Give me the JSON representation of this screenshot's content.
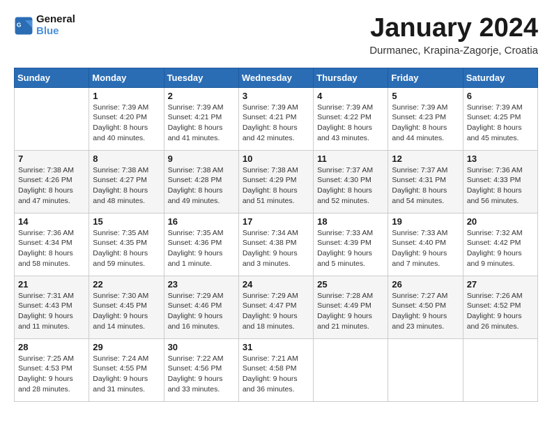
{
  "logo": {
    "line1": "General",
    "line2": "Blue"
  },
  "title": "January 2024",
  "subtitle": "Durmanec, Krapina-Zagorje, Croatia",
  "weekdays": [
    "Sunday",
    "Monday",
    "Tuesday",
    "Wednesday",
    "Thursday",
    "Friday",
    "Saturday"
  ],
  "weeks": [
    [
      {
        "day": "",
        "sunrise": "",
        "sunset": "",
        "daylight": ""
      },
      {
        "day": "1",
        "sunrise": "Sunrise: 7:39 AM",
        "sunset": "Sunset: 4:20 PM",
        "daylight": "Daylight: 8 hours and 40 minutes."
      },
      {
        "day": "2",
        "sunrise": "Sunrise: 7:39 AM",
        "sunset": "Sunset: 4:21 PM",
        "daylight": "Daylight: 8 hours and 41 minutes."
      },
      {
        "day": "3",
        "sunrise": "Sunrise: 7:39 AM",
        "sunset": "Sunset: 4:21 PM",
        "daylight": "Daylight: 8 hours and 42 minutes."
      },
      {
        "day": "4",
        "sunrise": "Sunrise: 7:39 AM",
        "sunset": "Sunset: 4:22 PM",
        "daylight": "Daylight: 8 hours and 43 minutes."
      },
      {
        "day": "5",
        "sunrise": "Sunrise: 7:39 AM",
        "sunset": "Sunset: 4:23 PM",
        "daylight": "Daylight: 8 hours and 44 minutes."
      },
      {
        "day": "6",
        "sunrise": "Sunrise: 7:39 AM",
        "sunset": "Sunset: 4:25 PM",
        "daylight": "Daylight: 8 hours and 45 minutes."
      }
    ],
    [
      {
        "day": "7",
        "sunrise": "Sunrise: 7:38 AM",
        "sunset": "Sunset: 4:26 PM",
        "daylight": "Daylight: 8 hours and 47 minutes."
      },
      {
        "day": "8",
        "sunrise": "Sunrise: 7:38 AM",
        "sunset": "Sunset: 4:27 PM",
        "daylight": "Daylight: 8 hours and 48 minutes."
      },
      {
        "day": "9",
        "sunrise": "Sunrise: 7:38 AM",
        "sunset": "Sunset: 4:28 PM",
        "daylight": "Daylight: 8 hours and 49 minutes."
      },
      {
        "day": "10",
        "sunrise": "Sunrise: 7:38 AM",
        "sunset": "Sunset: 4:29 PM",
        "daylight": "Daylight: 8 hours and 51 minutes."
      },
      {
        "day": "11",
        "sunrise": "Sunrise: 7:37 AM",
        "sunset": "Sunset: 4:30 PM",
        "daylight": "Daylight: 8 hours and 52 minutes."
      },
      {
        "day": "12",
        "sunrise": "Sunrise: 7:37 AM",
        "sunset": "Sunset: 4:31 PM",
        "daylight": "Daylight: 8 hours and 54 minutes."
      },
      {
        "day": "13",
        "sunrise": "Sunrise: 7:36 AM",
        "sunset": "Sunset: 4:33 PM",
        "daylight": "Daylight: 8 hours and 56 minutes."
      }
    ],
    [
      {
        "day": "14",
        "sunrise": "Sunrise: 7:36 AM",
        "sunset": "Sunset: 4:34 PM",
        "daylight": "Daylight: 8 hours and 58 minutes."
      },
      {
        "day": "15",
        "sunrise": "Sunrise: 7:35 AM",
        "sunset": "Sunset: 4:35 PM",
        "daylight": "Daylight: 8 hours and 59 minutes."
      },
      {
        "day": "16",
        "sunrise": "Sunrise: 7:35 AM",
        "sunset": "Sunset: 4:36 PM",
        "daylight": "Daylight: 9 hours and 1 minute."
      },
      {
        "day": "17",
        "sunrise": "Sunrise: 7:34 AM",
        "sunset": "Sunset: 4:38 PM",
        "daylight": "Daylight: 9 hours and 3 minutes."
      },
      {
        "day": "18",
        "sunrise": "Sunrise: 7:33 AM",
        "sunset": "Sunset: 4:39 PM",
        "daylight": "Daylight: 9 hours and 5 minutes."
      },
      {
        "day": "19",
        "sunrise": "Sunrise: 7:33 AM",
        "sunset": "Sunset: 4:40 PM",
        "daylight": "Daylight: 9 hours and 7 minutes."
      },
      {
        "day": "20",
        "sunrise": "Sunrise: 7:32 AM",
        "sunset": "Sunset: 4:42 PM",
        "daylight": "Daylight: 9 hours and 9 minutes."
      }
    ],
    [
      {
        "day": "21",
        "sunrise": "Sunrise: 7:31 AM",
        "sunset": "Sunset: 4:43 PM",
        "daylight": "Daylight: 9 hours and 11 minutes."
      },
      {
        "day": "22",
        "sunrise": "Sunrise: 7:30 AM",
        "sunset": "Sunset: 4:45 PM",
        "daylight": "Daylight: 9 hours and 14 minutes."
      },
      {
        "day": "23",
        "sunrise": "Sunrise: 7:29 AM",
        "sunset": "Sunset: 4:46 PM",
        "daylight": "Daylight: 9 hours and 16 minutes."
      },
      {
        "day": "24",
        "sunrise": "Sunrise: 7:29 AM",
        "sunset": "Sunset: 4:47 PM",
        "daylight": "Daylight: 9 hours and 18 minutes."
      },
      {
        "day": "25",
        "sunrise": "Sunrise: 7:28 AM",
        "sunset": "Sunset: 4:49 PM",
        "daylight": "Daylight: 9 hours and 21 minutes."
      },
      {
        "day": "26",
        "sunrise": "Sunrise: 7:27 AM",
        "sunset": "Sunset: 4:50 PM",
        "daylight": "Daylight: 9 hours and 23 minutes."
      },
      {
        "day": "27",
        "sunrise": "Sunrise: 7:26 AM",
        "sunset": "Sunset: 4:52 PM",
        "daylight": "Daylight: 9 hours and 26 minutes."
      }
    ],
    [
      {
        "day": "28",
        "sunrise": "Sunrise: 7:25 AM",
        "sunset": "Sunset: 4:53 PM",
        "daylight": "Daylight: 9 hours and 28 minutes."
      },
      {
        "day": "29",
        "sunrise": "Sunrise: 7:24 AM",
        "sunset": "Sunset: 4:55 PM",
        "daylight": "Daylight: 9 hours and 31 minutes."
      },
      {
        "day": "30",
        "sunrise": "Sunrise: 7:22 AM",
        "sunset": "Sunset: 4:56 PM",
        "daylight": "Daylight: 9 hours and 33 minutes."
      },
      {
        "day": "31",
        "sunrise": "Sunrise: 7:21 AM",
        "sunset": "Sunset: 4:58 PM",
        "daylight": "Daylight: 9 hours and 36 minutes."
      },
      {
        "day": "",
        "sunrise": "",
        "sunset": "",
        "daylight": ""
      },
      {
        "day": "",
        "sunrise": "",
        "sunset": "",
        "daylight": ""
      },
      {
        "day": "",
        "sunrise": "",
        "sunset": "",
        "daylight": ""
      }
    ]
  ]
}
